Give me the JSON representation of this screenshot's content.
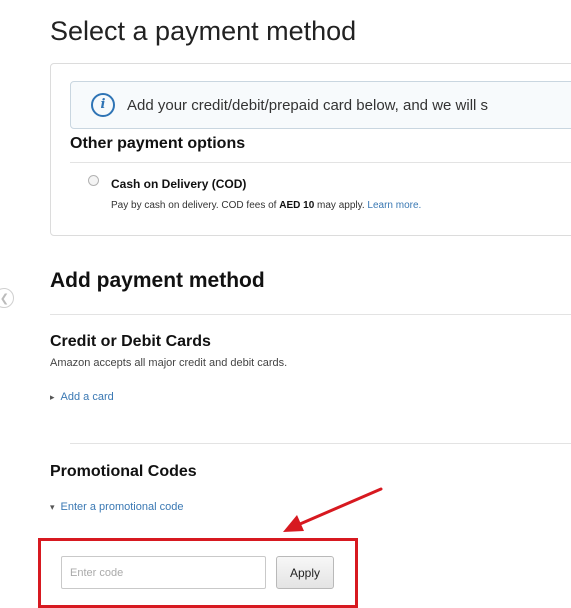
{
  "page": {
    "title": "Select a payment method"
  },
  "info_alert": {
    "icon": "info-icon",
    "icon_glyph": "i",
    "text": "Add your credit/debit/prepaid card below, and we will s"
  },
  "other_options": {
    "heading": "Other payment options",
    "cod": {
      "label": "Cash on Delivery (COD)",
      "desc_prefix": "Pay by cash on delivery. COD fees of ",
      "desc_fee": "AED 10",
      "desc_suffix": " may apply. ",
      "learn_more": "Learn more."
    }
  },
  "add_payment": {
    "heading": "Add payment method",
    "cards": {
      "heading": "Credit or Debit Cards",
      "subtext": "Amazon accepts all major credit and debit cards.",
      "add_card_link": "Add a card"
    },
    "promo": {
      "heading": "Promotional Codes",
      "enter_code_link": "Enter a promotional code",
      "input_placeholder": "Enter code",
      "input_value": "",
      "apply_label": "Apply"
    }
  },
  "colors": {
    "link": "#3a78b3",
    "highlight": "#d71920",
    "info_icon": "#2f74b5"
  }
}
